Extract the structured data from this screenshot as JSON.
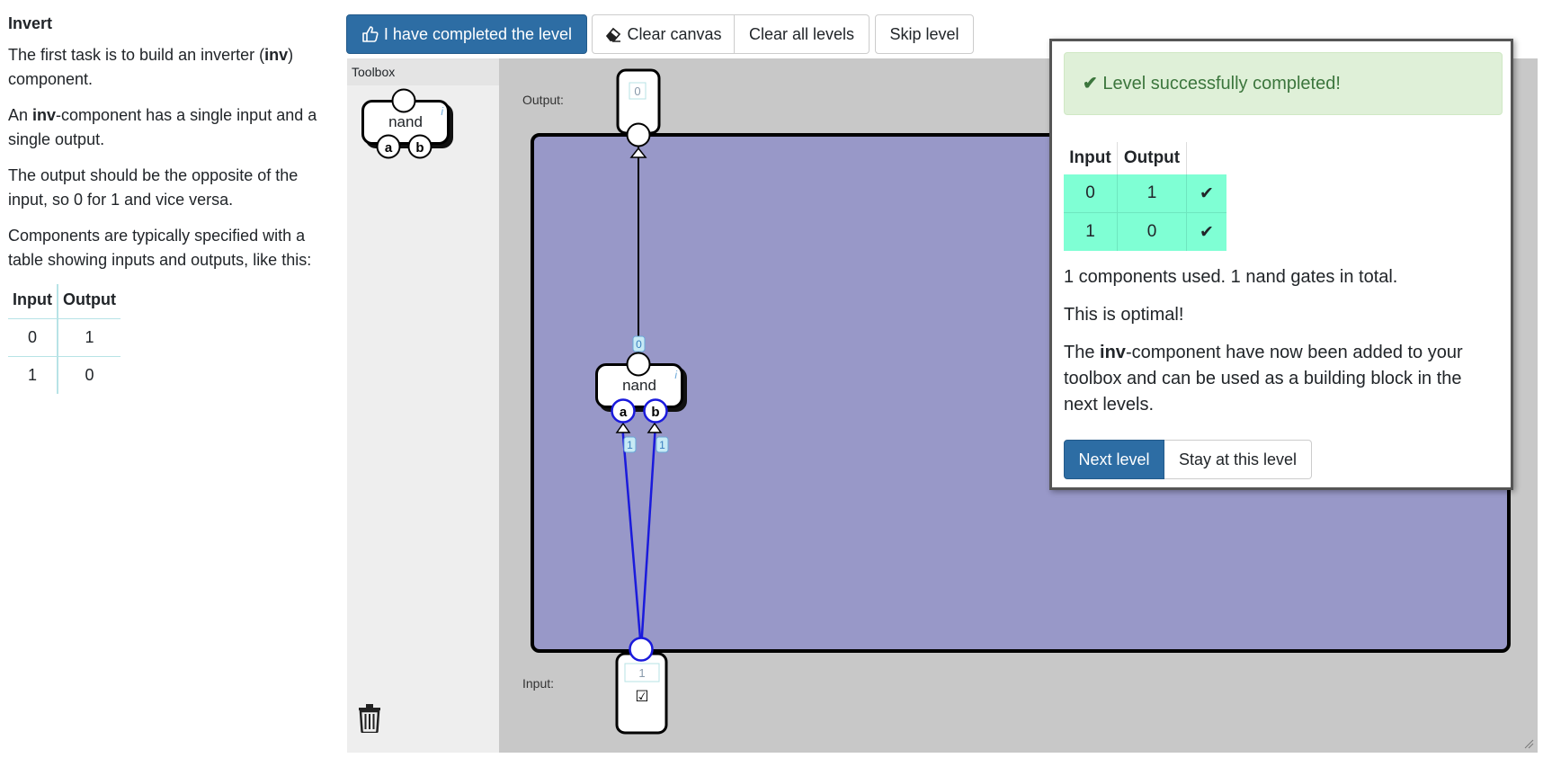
{
  "lesson": {
    "title": "Invert",
    "p1_before": "The first task is to build an inverter (",
    "p1_bold": "inv",
    "p1_after": ") component.",
    "p2_before": "An ",
    "p2_bold": "inv",
    "p2_after": "-component has a single input and a single output.",
    "p3": "The output should be the opposite of the input, so 0 for 1 and vice versa.",
    "p4": "Components are typically specified with a table showing inputs and outputs, like this:",
    "table": {
      "headers": [
        "Input",
        "Output"
      ],
      "rows": [
        [
          "0",
          "1"
        ],
        [
          "1",
          "0"
        ]
      ]
    }
  },
  "toolbar": {
    "completed_label": "I have completed the level",
    "clear_canvas_label": "Clear canvas",
    "clear_all_label": "Clear all levels",
    "skip_label": "Skip level"
  },
  "toolbox": {
    "header": "Toolbox",
    "gate_label": "nand",
    "pin_a": "a",
    "pin_b": "b",
    "info_glyph": "i"
  },
  "canvas": {
    "output_label": "Output:",
    "input_label": "Input:",
    "output_value": "0",
    "input_value": "1",
    "input_checkbox": "☑",
    "gate_label": "nand",
    "gate_pin_a": "a",
    "gate_pin_b": "b",
    "gate_info": "i",
    "gate_output_value": "0",
    "wire_a_value": "1",
    "wire_b_value": "1",
    "area_color": "#9898c8",
    "active_wire_color": "#1a1adc"
  },
  "modal": {
    "alert": "Level successfully completed!",
    "alert_icon": "check-icon",
    "table": {
      "headers": [
        "Input",
        "Output"
      ],
      "rows": [
        {
          "input": "0",
          "output": "1",
          "check": "✔"
        },
        {
          "input": "1",
          "output": "0",
          "check": "✔"
        }
      ]
    },
    "stats": "1 components used. 1 nand gates in total.",
    "optimal": "This is optimal!",
    "added_before": "The ",
    "added_bold": "inv",
    "added_after": "-component have now been added to your toolbox and can be used as a building block in the next levels.",
    "next_label": "Next level",
    "stay_label": "Stay at this level"
  }
}
